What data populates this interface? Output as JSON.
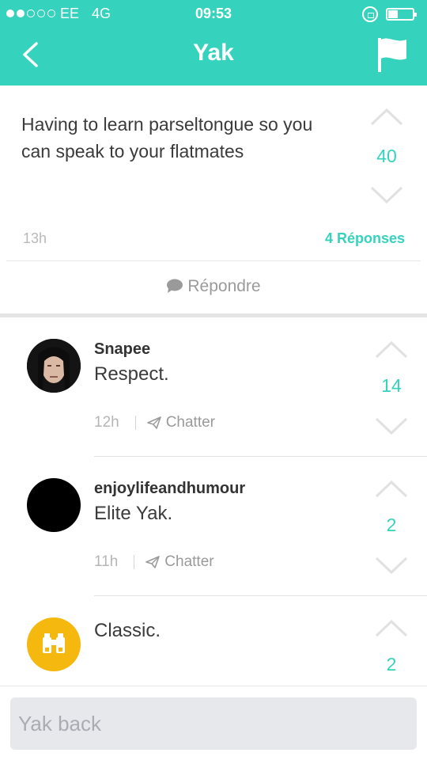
{
  "status_bar": {
    "carrier": "EE",
    "network": "4G",
    "time": "09:53"
  },
  "header": {
    "title": "Yak"
  },
  "post": {
    "text": "Having to learn parseltongue so you can speak to your flatmates",
    "votes": "40",
    "time": "13h",
    "replies_label": "4 Réponses",
    "reply_action": "Répondre"
  },
  "comments": [
    {
      "username": "Snapee",
      "text": "Respect.",
      "votes": "14",
      "time": "12h",
      "chat_label": "Chatter",
      "avatar": "snape-portrait"
    },
    {
      "username": "enjoylifeandhumour",
      "text": "Elite Yak.",
      "votes": "2",
      "time": "11h",
      "chat_label": "Chatter",
      "avatar": "black-circle"
    },
    {
      "username": "",
      "text": "Classic.",
      "votes": "2",
      "avatar": "binoculars-icon"
    }
  ],
  "composer": {
    "placeholder": "Yak back"
  },
  "colors": {
    "accent": "#35d3bd",
    "avatar_yellow": "#f5b80f"
  }
}
